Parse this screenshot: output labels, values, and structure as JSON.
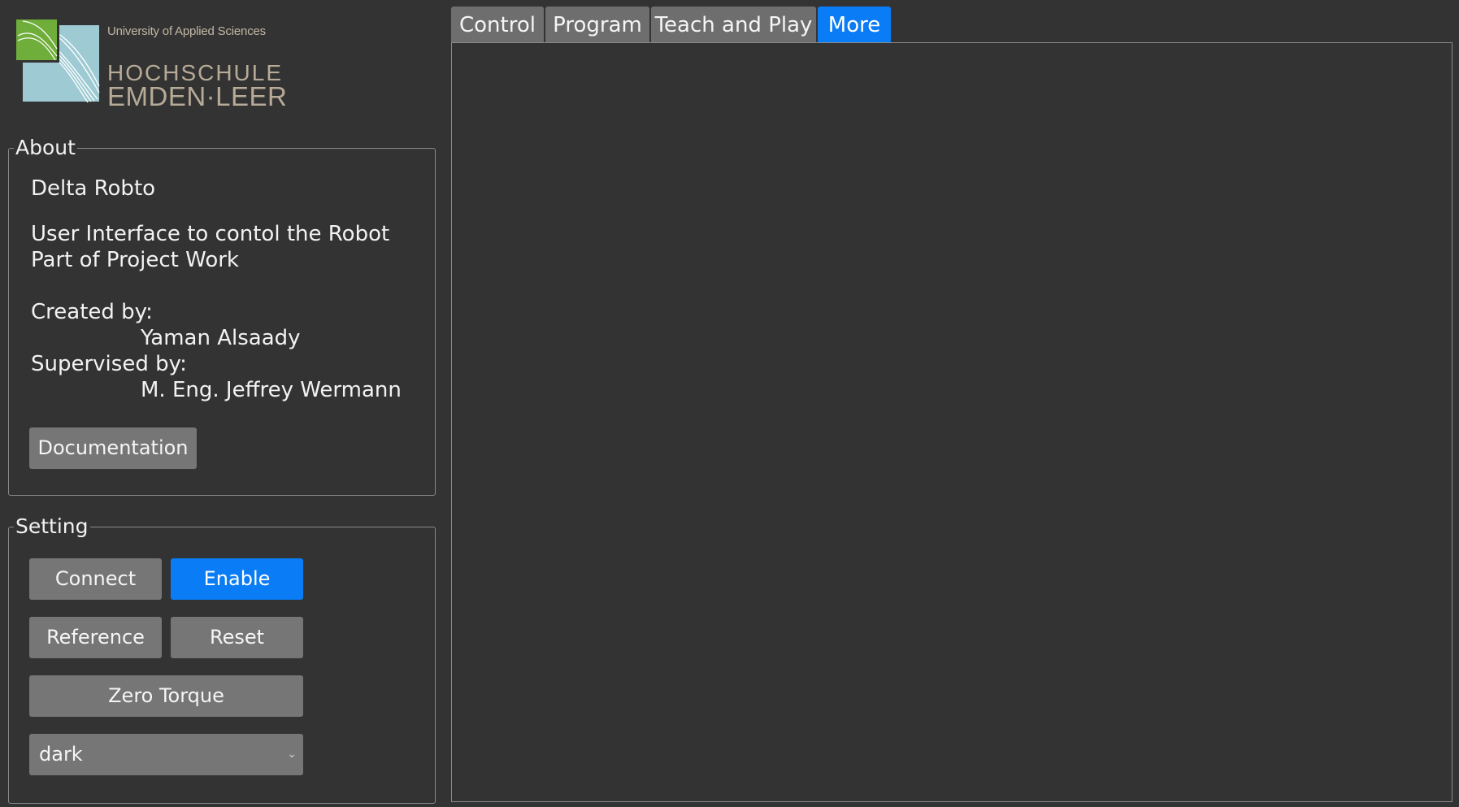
{
  "logo": {
    "subtitle": "University of Applied Sciences",
    "line1": "HOCHSCHULE",
    "line2": "EMDEN·LEER",
    "colors": {
      "green": "#6fae3a",
      "blue": "#9dcad3",
      "text": "#b7ab97"
    }
  },
  "about": {
    "title": "About",
    "name": "Delta Robto",
    "desc_line1": "User Interface to contol the Robot",
    "desc_line2": "Part of Project Work",
    "created_label": "Created by:",
    "created_name": "Yaman Alsaady",
    "supervised_label": "Supervised by:",
    "supervised_name": "M. Eng. Jeffrey Wermann",
    "documentation_button": "Documentation"
  },
  "setting": {
    "title": "Setting",
    "connect_button": "Connect",
    "enable_button": "Enable",
    "reference_button": "Reference",
    "reset_button": "Reset",
    "zero_torque_button": "Zero Torque",
    "theme_select": {
      "value": "dark",
      "icon": "chevron-down-icon"
    }
  },
  "tabs": [
    {
      "label": "Control",
      "active": false
    },
    {
      "label": "Program",
      "active": false
    },
    {
      "label": "Teach and Play",
      "active": false
    },
    {
      "label": "More",
      "active": true
    }
  ],
  "colors": {
    "background": "#333333",
    "accent": "#0a7cf5",
    "button": "#767676"
  }
}
